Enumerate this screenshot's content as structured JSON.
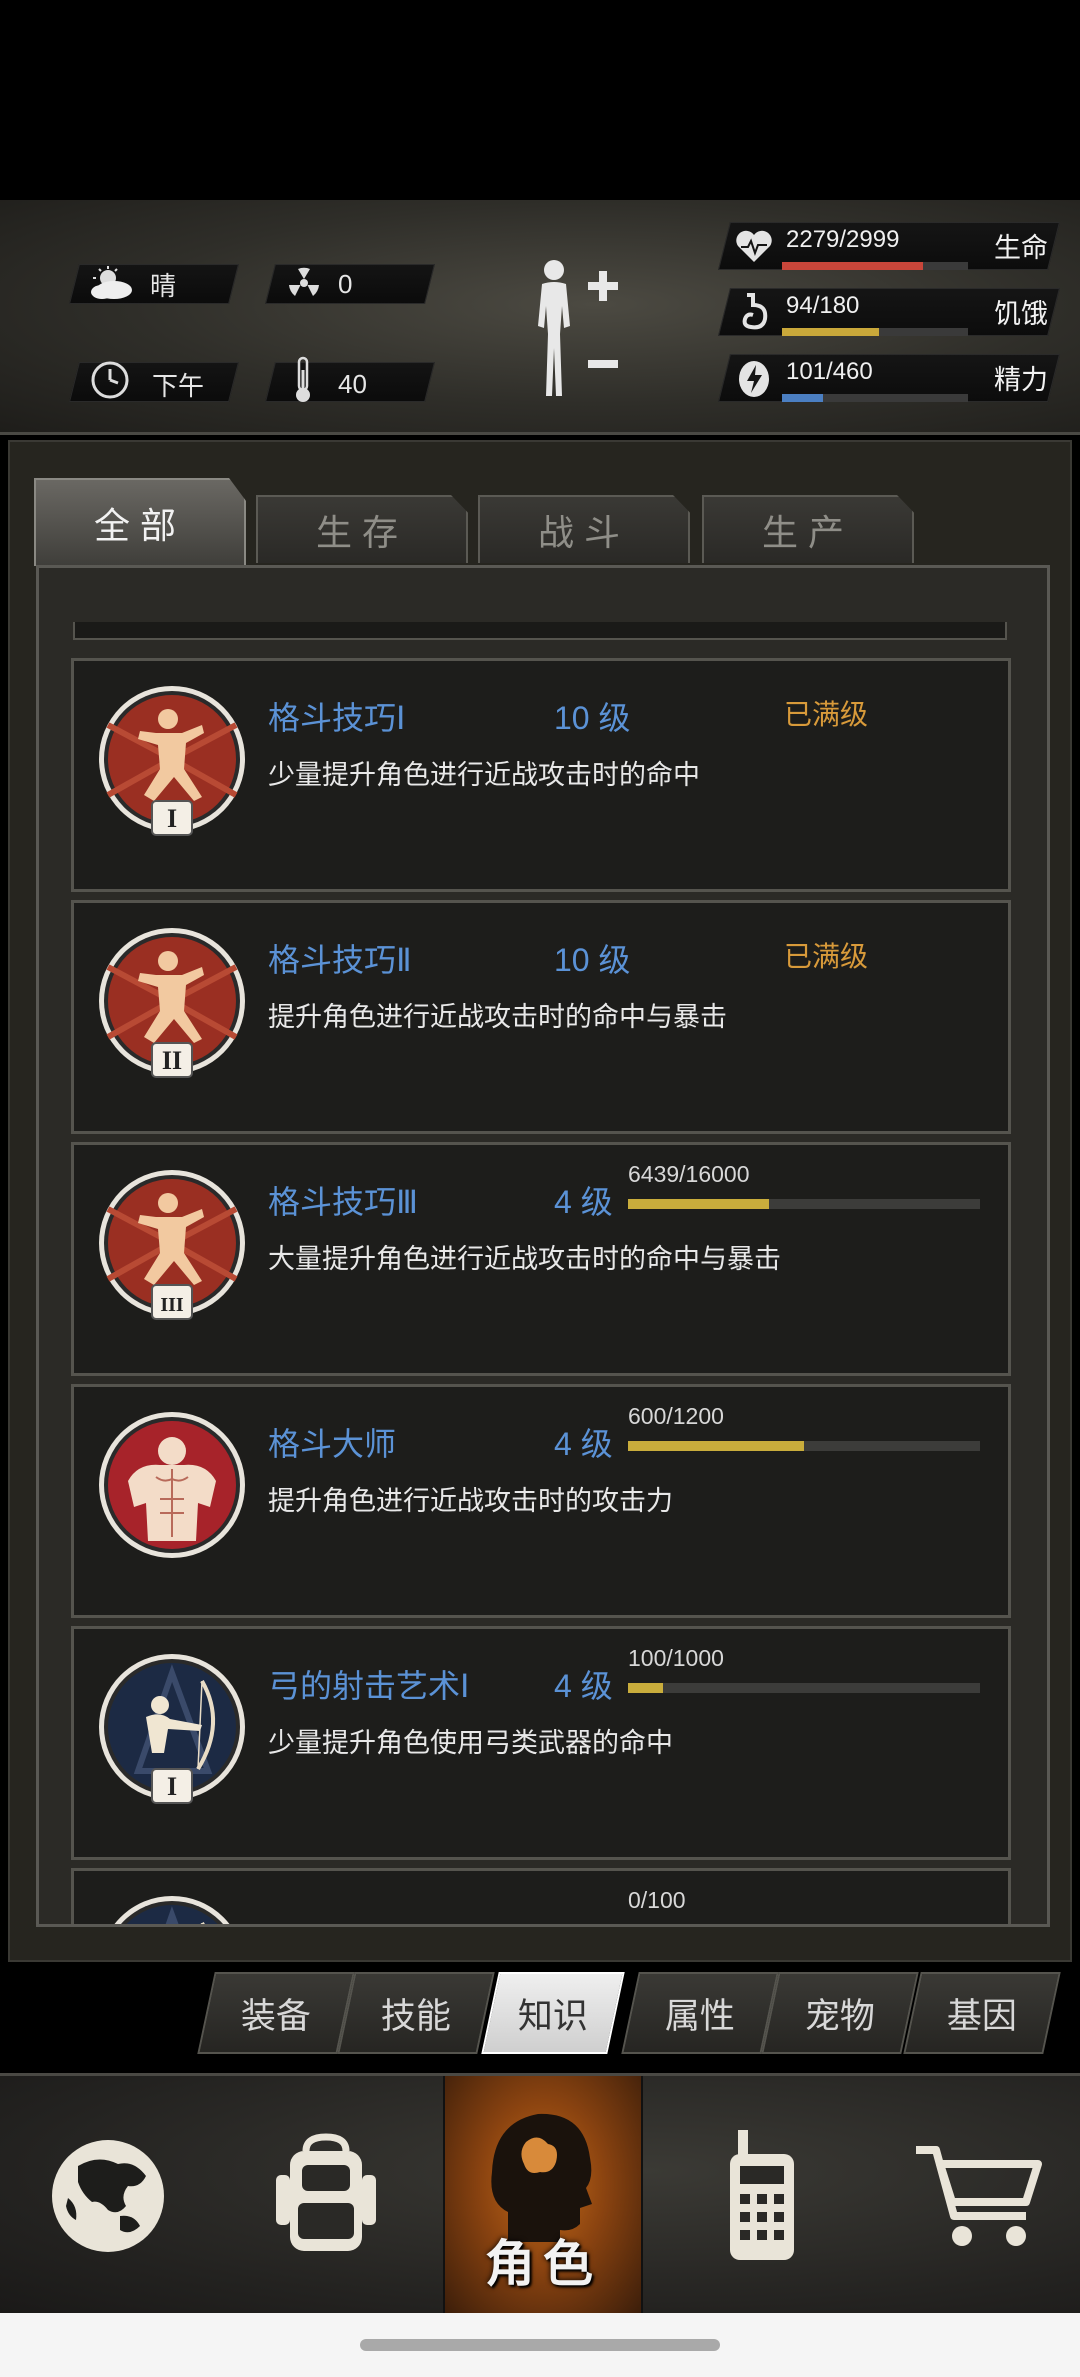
{
  "status": {
    "weather": "晴",
    "radiation": "0",
    "time_of_day": "下午",
    "temperature": "40",
    "life": {
      "value": "2279/2999",
      "label": "生命",
      "fraction": 0.76,
      "color": "#c8463a"
    },
    "hunger": {
      "value": "94/180",
      "label": "饥饿",
      "fraction": 0.52,
      "color": "#c9a83a"
    },
    "energy": {
      "value": "101/460",
      "label": "精力",
      "fraction": 0.22,
      "color": "#4b7fc2"
    }
  },
  "tabs": [
    "全部",
    "生存",
    "战斗",
    "生产"
  ],
  "active_tab": "全部",
  "skills": [
    {
      "name": "格斗技巧Ⅰ",
      "level": "10 级",
      "desc": "少量提升角色进行近战攻击时的命中",
      "maxed": "已满级",
      "icon": "fighter-icon",
      "numeral": "I"
    },
    {
      "name": "格斗技巧Ⅱ",
      "level": "10 级",
      "desc": "提升角色进行近战攻击时的命中与暴击",
      "maxed": "已满级",
      "icon": "fighter-icon",
      "numeral": "II"
    },
    {
      "name": "格斗技巧Ⅲ",
      "level": "4 级",
      "desc": "大量提升角色进行近战攻击时的命中与暴击",
      "xp": "6439/16000",
      "xp_fraction": 0.4,
      "icon": "fighter-icon",
      "numeral": "III"
    },
    {
      "name": "格斗大师",
      "level": "4 级",
      "desc": "提升角色进行近战攻击时的攻击力",
      "xp": "600/1200",
      "xp_fraction": 0.5,
      "icon": "muscle-icon",
      "numeral": ""
    },
    {
      "name": "弓的射击艺术Ⅰ",
      "level": "4 级",
      "desc": "少量提升角色使用弓类武器的命中",
      "xp": "100/1000",
      "xp_fraction": 0.1,
      "icon": "archer-icon",
      "numeral": "I"
    },
    {
      "name": "",
      "level": "",
      "desc": "",
      "xp": "0/100",
      "xp_fraction": 0.0,
      "icon": "archer-icon",
      "numeral": ""
    }
  ],
  "subtabs": [
    "装备",
    "技能",
    "知识",
    "属性",
    "宠物",
    "基因"
  ],
  "active_subtab": "知识",
  "nav": {
    "items": [
      "globe-icon",
      "backpack-icon",
      "character-icon",
      "radio-icon",
      "cart-icon"
    ],
    "active_label": "角色"
  }
}
